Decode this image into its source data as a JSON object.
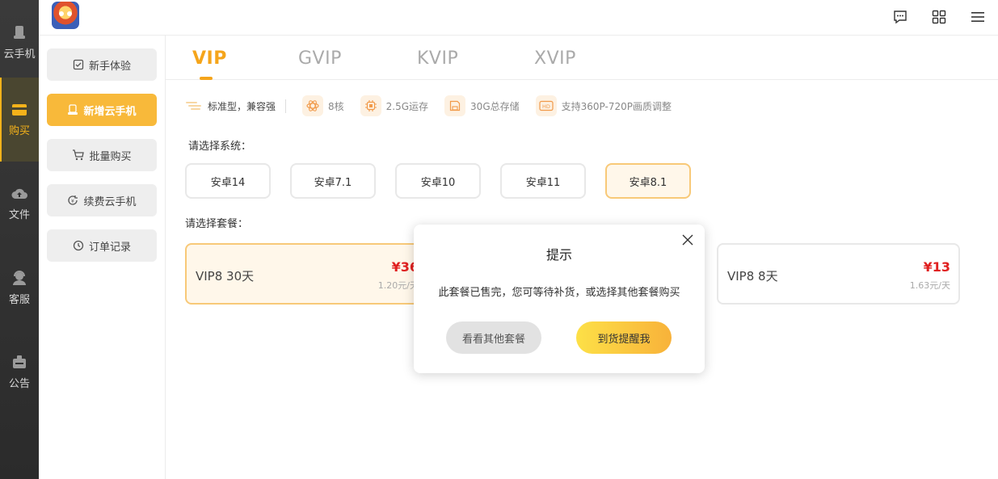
{
  "rail": {
    "items": [
      {
        "label": "云手机",
        "icon": "phone-icon"
      },
      {
        "label": "购买",
        "icon": "cart-card-icon",
        "active": true
      },
      {
        "label": "文件",
        "icon": "cloud-upload-icon"
      },
      {
        "label": "客服",
        "icon": "headset-icon"
      },
      {
        "label": "公告",
        "icon": "notice-icon"
      }
    ]
  },
  "topbar": {
    "icons": [
      "message-icon",
      "grid-icon",
      "menu-icon"
    ]
  },
  "submenu": {
    "items": [
      {
        "label": "新手体验",
        "icon": "trial-icon"
      },
      {
        "label": "新增云手机",
        "icon": "add-phone-icon",
        "active": true
      },
      {
        "label": "批量购买",
        "icon": "cart-icon"
      },
      {
        "label": "续费云手机",
        "icon": "renew-icon"
      },
      {
        "label": "订单记录",
        "icon": "clock-icon"
      }
    ]
  },
  "tabs": [
    {
      "label": "VIP",
      "active": true
    },
    {
      "label": "GVIP"
    },
    {
      "label": "KVIP"
    },
    {
      "label": "XVIP"
    }
  ],
  "specs": {
    "type": "标准型，兼容强",
    "cores": "8核",
    "ram": "2.5G运存",
    "storage": "30G总存储",
    "quality": "支持360P-720P画质调整"
  },
  "system": {
    "label": "请选择系统：",
    "options": [
      "安卓14",
      "安卓7.1",
      "安卓10",
      "安卓11",
      "安卓8.1"
    ],
    "selected": "安卓8.1"
  },
  "plans": {
    "label": "请选择套餐：",
    "items": [
      {
        "name": "VIP8 30天",
        "price": "¥36",
        "per_day": "1.20元/天",
        "active": true
      },
      {
        "name": "VIP8 8天",
        "price": "¥13",
        "per_day": "1.63元/天"
      }
    ]
  },
  "modal": {
    "title": "提示",
    "message": "此套餐已售完，您可等待补货，或选择其他套餐购买",
    "secondary_label": "看看其他套餐",
    "primary_label": "到货提醒我"
  },
  "colors": {
    "accent": "#f5a51b",
    "price": "#e02020",
    "rail_bg": "#2b2b2b"
  }
}
